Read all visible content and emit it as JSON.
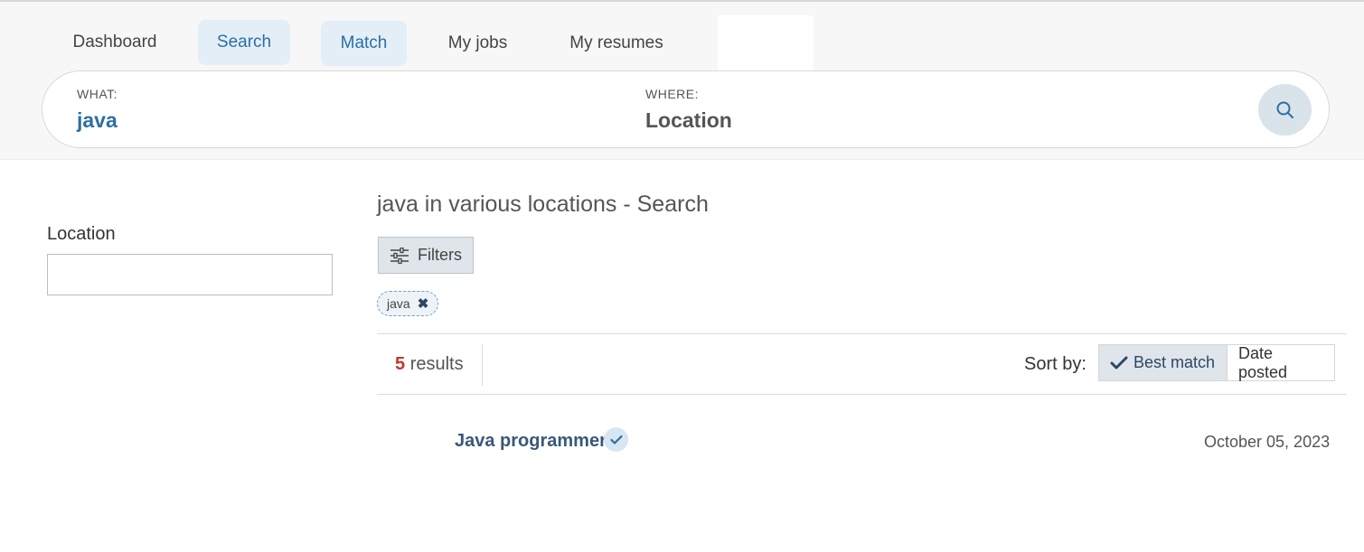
{
  "nav": {
    "tabs": [
      {
        "label": "Dashboard"
      },
      {
        "label": "Search"
      },
      {
        "label": "Match"
      },
      {
        "label": "My jobs"
      },
      {
        "label": "My resumes"
      }
    ]
  },
  "search": {
    "what_label": "WHAT:",
    "what_value": "java",
    "where_label": "WHERE:",
    "where_value": "Location"
  },
  "sidebar": {
    "location_label": "Location",
    "location_value": ""
  },
  "main": {
    "title": "java in various locations - Search",
    "filters_label": "Filters",
    "chip_label": "java",
    "results_count": "5",
    "results_word": "results",
    "sort_label": "Sort by:",
    "sort_options": [
      {
        "label": "Best match",
        "selected": true
      },
      {
        "label": "Date posted",
        "selected": false
      }
    ]
  },
  "jobs": [
    {
      "title": "Java programmer",
      "date": "October 05, 2023",
      "verified": true
    }
  ],
  "colors": {
    "accent": "#2c6fa3",
    "active_tab_bg": "#e3eef7",
    "results_count": "#c0392b"
  }
}
